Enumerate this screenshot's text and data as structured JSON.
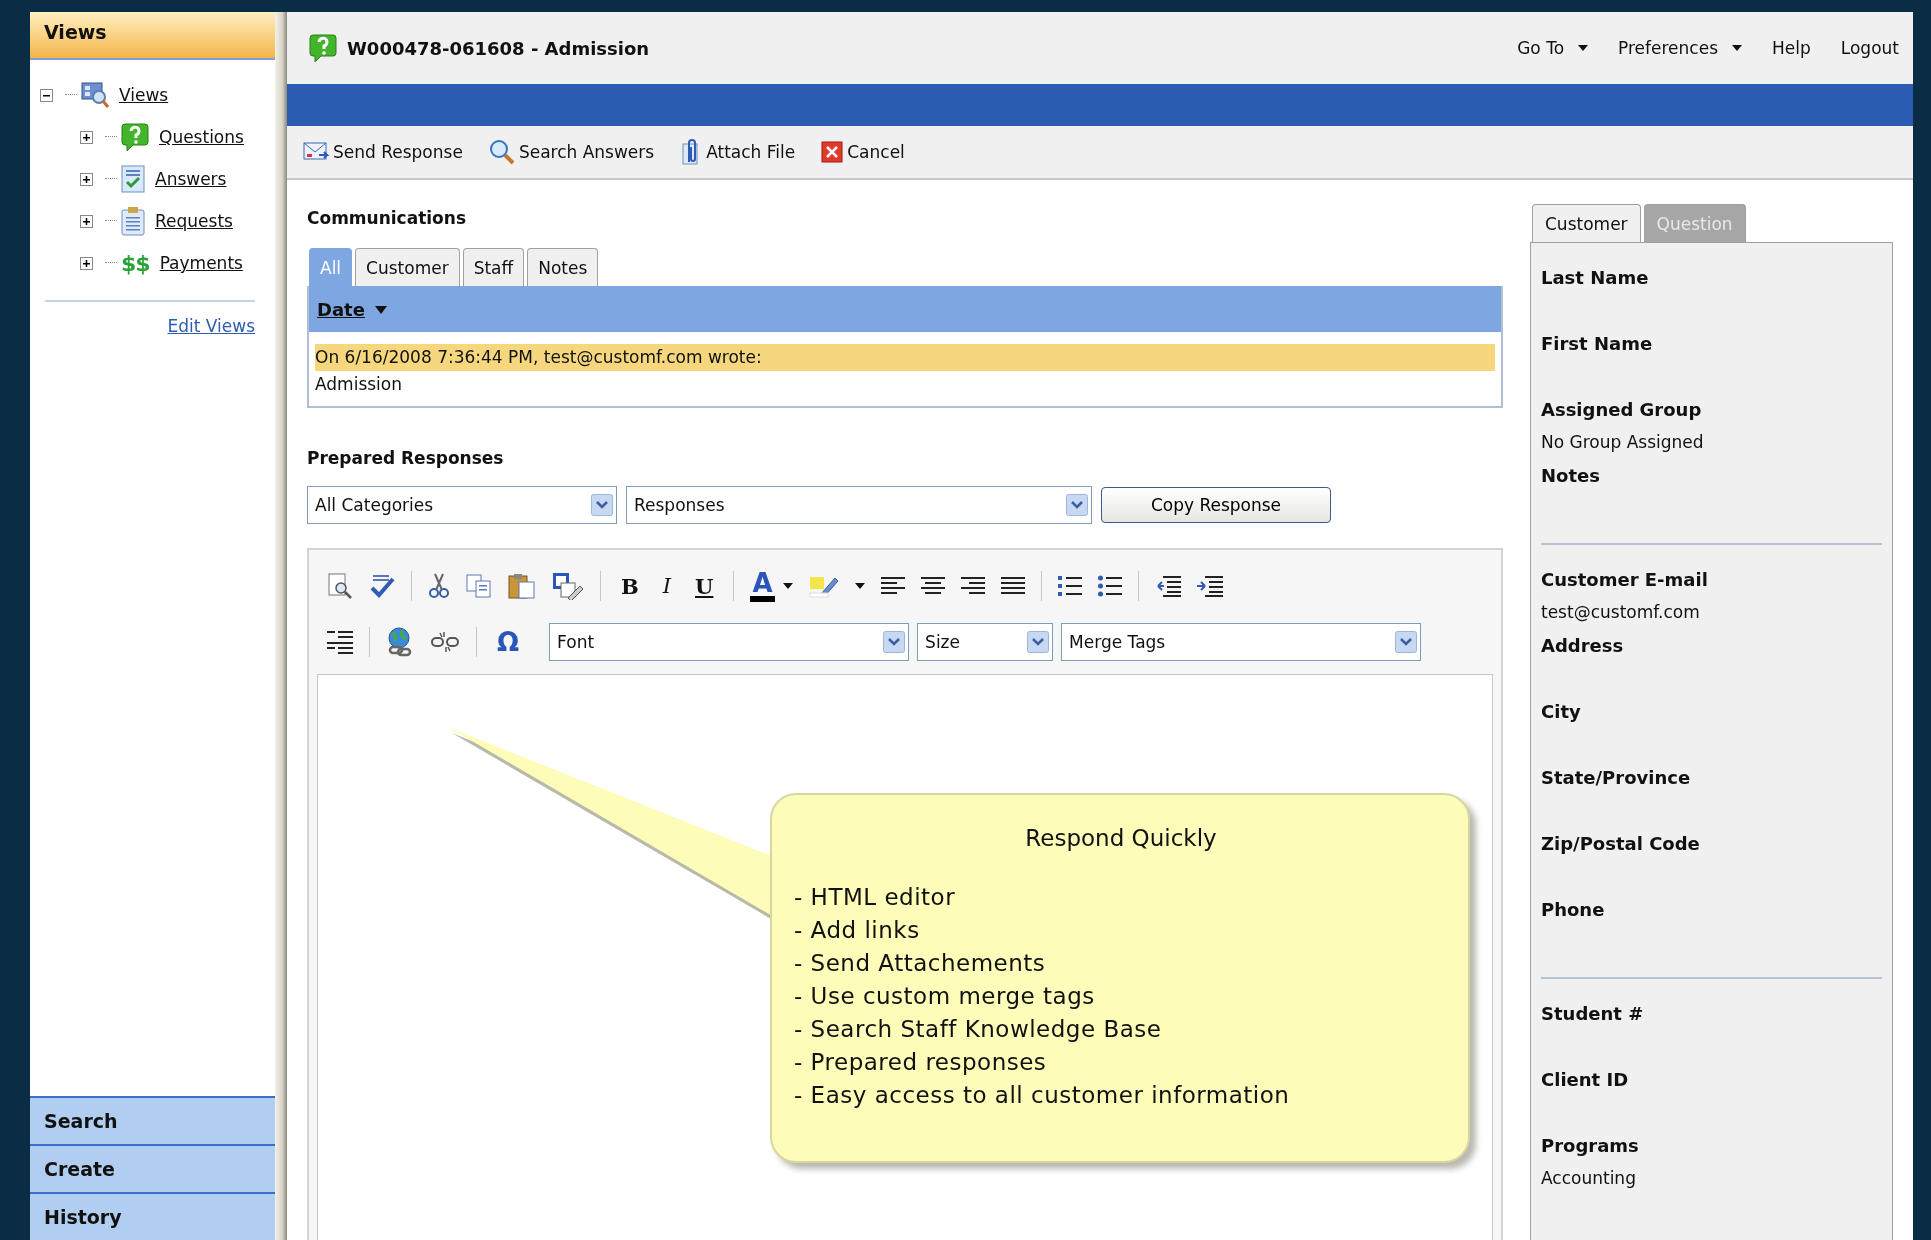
{
  "sidebar": {
    "title": "Views",
    "tree": {
      "label": "Views",
      "expanded": true,
      "children": [
        {
          "label": "Questions",
          "expanded": false
        },
        {
          "label": "Answers",
          "expanded": false
        },
        {
          "label": "Requests",
          "expanded": false
        },
        {
          "label": "Payments",
          "expanded": false,
          "icon_text": "$$"
        }
      ]
    },
    "edit_link": "Edit Views",
    "sections": [
      "Search",
      "Create",
      "History"
    ]
  },
  "header": {
    "title": "W000478-061608 - Admission",
    "menu": [
      {
        "label": "Go To",
        "dropdown": true
      },
      {
        "label": "Preferences",
        "dropdown": true
      },
      {
        "label": "Help",
        "dropdown": false
      },
      {
        "label": "Logout",
        "dropdown": false
      }
    ]
  },
  "toolbar": [
    {
      "label": "Send Response",
      "kind": "send"
    },
    {
      "label": "Search Answers",
      "kind": "search"
    },
    {
      "label": "Attach File",
      "kind": "attach"
    },
    {
      "label": "Cancel",
      "kind": "cancel"
    }
  ],
  "communications": {
    "heading": "Communications",
    "tabs": [
      {
        "label": "All",
        "selected": true
      },
      {
        "label": "Customer",
        "selected": false
      },
      {
        "label": "Staff",
        "selected": false
      },
      {
        "label": "Notes",
        "selected": false
      }
    ],
    "sort_column": "Date",
    "messages": [
      {
        "header": "On 6/16/2008 7:36:44 PM, test@customf.com wrote:",
        "body": "Admission"
      }
    ]
  },
  "prepared_responses": {
    "heading": "Prepared Responses",
    "category": "All Categories",
    "response": "Responses",
    "button": "Copy Response"
  },
  "editor": {
    "rows": [
      [
        {
          "kind": "preview"
        },
        {
          "kind": "spellcheck"
        },
        {
          "kind": "separator"
        },
        {
          "kind": "cut"
        },
        {
          "kind": "copy"
        },
        {
          "kind": "paste"
        },
        {
          "kind": "paste-word"
        },
        {
          "kind": "separator"
        },
        {
          "kind": "bold",
          "glyph": "B"
        },
        {
          "kind": "italic",
          "glyph": "I"
        },
        {
          "kind": "underline",
          "glyph": "U"
        },
        {
          "kind": "separator"
        },
        {
          "kind": "font-color",
          "glyph": "A"
        },
        {
          "kind": "highlight"
        },
        {
          "kind": "align-left"
        },
        {
          "kind": "align-center"
        },
        {
          "kind": "align-right"
        },
        {
          "kind": "justify"
        },
        {
          "kind": "separator"
        },
        {
          "kind": "ordered-list"
        },
        {
          "kind": "bullet-list"
        },
        {
          "kind": "separator"
        },
        {
          "kind": "outdent"
        },
        {
          "kind": "indent"
        }
      ],
      [
        {
          "kind": "format"
        },
        {
          "kind": "separator"
        },
        {
          "kind": "link"
        },
        {
          "kind": "unlink"
        },
        {
          "kind": "separator"
        },
        {
          "kind": "special-char",
          "glyph": "Ω"
        },
        {
          "kind": "font-select",
          "value": "Font"
        },
        {
          "kind": "size-select",
          "value": "Size"
        },
        {
          "kind": "merge-select",
          "value": "Merge Tags"
        }
      ]
    ]
  },
  "callout": {
    "title": "Respond Quickly",
    "items": [
      "- HTML editor",
      "- Add links",
      "- Send Attachements",
      "- Use custom merge tags",
      "- Search Staff Knowledge Base",
      "- Prepared responses",
      "- Easy access to all customer information"
    ]
  },
  "details": {
    "tabs": [
      {
        "label": "Customer",
        "selected": true
      },
      {
        "label": "Question",
        "selected": false
      }
    ],
    "groups": [
      [
        {
          "label": "Last Name"
        },
        {
          "label": "First Name"
        },
        {
          "label": "Assigned Group",
          "value": "No Group Assigned"
        },
        {
          "label": "Notes"
        }
      ],
      [
        {
          "label": "Customer E-mail",
          "value": "test@customf.com"
        },
        {
          "label": "Address"
        },
        {
          "label": "City"
        },
        {
          "label": "State/Province"
        },
        {
          "label": "Zip/Postal Code"
        },
        {
          "label": "Phone"
        }
      ],
      [
        {
          "label": "Student #"
        },
        {
          "label": "Client ID"
        },
        {
          "label": "Programs",
          "value": "Accounting"
        }
      ]
    ]
  }
}
